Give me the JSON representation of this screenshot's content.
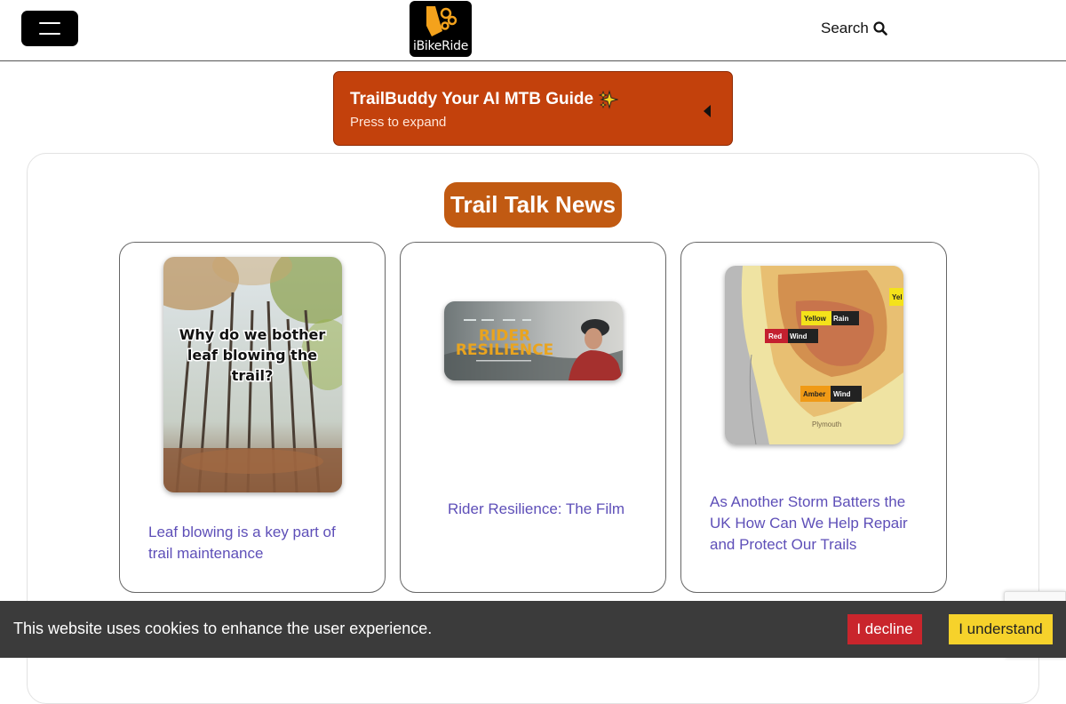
{
  "header": {
    "brand": "iBikeRide",
    "search_label": "Search",
    "menu_icon": "hamburger-icon",
    "search_icon": "magnifier-icon"
  },
  "banner": {
    "title": "TrailBuddy Your AI MTB Guide",
    "subtitle": "Press to expand",
    "icon": "sparkles-icon"
  },
  "news": {
    "section_title": "Trail Talk News",
    "cards": [
      {
        "caption": "Leaf blowing is a key part of trail maintenance",
        "image_text": "Why do we bother leaf blowing the trail?"
      },
      {
        "caption": "Rider Resilience: The Film",
        "image_text": "RIDER RESILIENCE"
      },
      {
        "caption": "As Another Storm Batters the UK How Can We Help Repair and Protect Our Trails",
        "map_labels": {
          "yellow": "Yellow",
          "rain": "Rain",
          "red": "Red",
          "wind": "Wind",
          "amber": "Amber",
          "wind2": "Wind",
          "city": "Plymouth",
          "edge": "Yel"
        }
      }
    ]
  },
  "cookie": {
    "message": "This website uses cookies to enhance the user experience.",
    "decline_label": "I decline",
    "accept_label": "I understand"
  },
  "colors": {
    "banner": "#c3410c",
    "section_title": "#c15a12",
    "caption_link": "#5e4fb8",
    "decline": "#c9252c",
    "accept": "#f6d22b"
  }
}
